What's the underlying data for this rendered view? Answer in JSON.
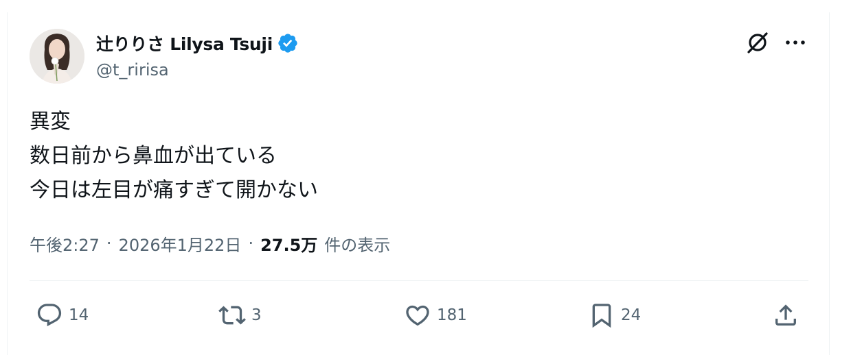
{
  "author": {
    "display_name": "辻りりさ Lilysa Tsuji",
    "handle": "@t_ririsa",
    "verified": true
  },
  "tweet": {
    "lines": [
      "異変",
      "数日前から鼻血が出ている",
      "今日は左目が痛すぎて開かない"
    ]
  },
  "meta": {
    "time": "午後2:27",
    "separator": "·",
    "date": "2026年1月22日",
    "views_count": "27.5万",
    "views_label": "件の表示"
  },
  "actions": {
    "replies": "14",
    "reposts": "3",
    "likes": "181",
    "bookmarks": "24"
  },
  "colors": {
    "text": "#0f1419",
    "secondary": "#536471",
    "verified": "#1d9bf0",
    "divider": "#eff3f4"
  },
  "icons": {
    "grok": "grok-icon",
    "more": "more-icon",
    "reply": "reply-icon",
    "repost": "repost-icon",
    "like": "heart-icon",
    "bookmark": "bookmark-icon",
    "share": "share-icon"
  }
}
